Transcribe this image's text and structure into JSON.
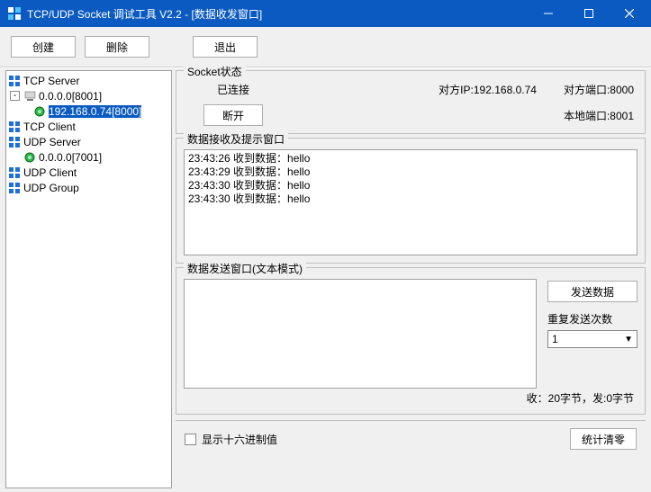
{
  "titlebar": {
    "text": "TCP/UDP Socket 调试工具 V2.2 - [数据收发窗口]"
  },
  "toolbar": {
    "create": "创建",
    "delete": "删除",
    "exit": "退出"
  },
  "tree": {
    "tcp_server": "TCP Server",
    "tcp_server_node": "0.0.0.0[8001]",
    "tcp_server_client": "192.168.0.74[8000]",
    "tcp_client": "TCP Client",
    "udp_server": "UDP Server",
    "udp_server_node": "0.0.0.0[7001]",
    "udp_client": "UDP Client",
    "udp_group": "UDP Group"
  },
  "socket": {
    "group_title": "Socket状态",
    "status": "已连接",
    "peer_ip_label": "对方IP",
    "peer_ip": "192.168.0.74",
    "peer_port_label": "对方端口",
    "peer_port": "8000",
    "disconnect": "断开",
    "local_port_label": "本地端口",
    "local_port": "8001"
  },
  "recv": {
    "group_title": "数据接收及提示窗口",
    "lines": "23:43:26 收到数据：hello\n23:43:29 收到数据：hello\n23:43:30 收到数据：hello\n23:43:30 收到数据：hello"
  },
  "send": {
    "group_title": "数据发送窗口(文本模式)",
    "send_btn": "发送数据",
    "repeat_label": "重复发送次数",
    "repeat_value": "1",
    "input_value": ""
  },
  "stats": {
    "text": "收：20字节，发:0字节"
  },
  "footer": {
    "hex_label": "显示十六进制值",
    "clear_btn": "统计清零"
  }
}
